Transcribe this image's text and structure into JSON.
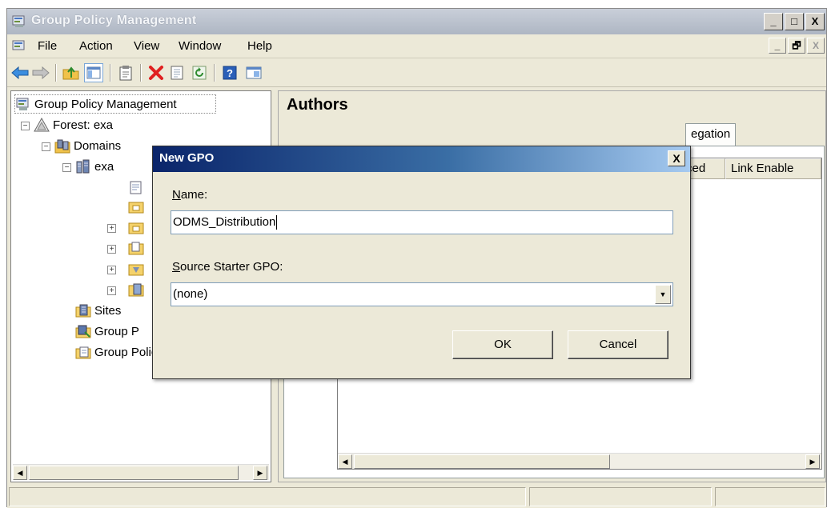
{
  "window": {
    "title": "Group Policy Management",
    "controls": [
      "_",
      "□",
      "X"
    ]
  },
  "menubar": {
    "items": [
      "File",
      "Action",
      "View",
      "Window",
      "Help"
    ],
    "mdi_controls": [
      "_",
      "🗗",
      "X"
    ]
  },
  "toolbar": {
    "icons": [
      "back-arrow-icon",
      "forward-arrow-icon",
      "up-folder-icon",
      "show-hide-tree-icon",
      "clipboard-icon",
      "delete-icon",
      "properties-icon",
      "refresh-icon",
      "help-icon",
      "console-icon"
    ]
  },
  "tree": {
    "root": "Group Policy Management",
    "forest": "Forest: exa",
    "domains": "Domains",
    "domain": "exa",
    "sites": "Sites",
    "modeling": "Group P",
    "results": "Group Policy Results"
  },
  "right_pane": {
    "title": "Authors",
    "tab_label": "egation",
    "columns": [
      "ced",
      "Link Enable"
    ]
  },
  "dialog": {
    "title": "New GPO",
    "close": "X",
    "name_label": "Name:",
    "name_access_key": "N",
    "name_label_rest": "ame:",
    "name_value": "ODMS_Distribution",
    "source_label_key": "S",
    "source_label_rest": "ource Starter GPO:",
    "source_value": "(none)",
    "ok_label": "OK",
    "cancel_label": "Cancel"
  },
  "colors": {
    "dialog_title_gradient_start": "#0a246a",
    "dialog_title_gradient_end": "#a6caf0",
    "window_face": "#ece9d8"
  }
}
